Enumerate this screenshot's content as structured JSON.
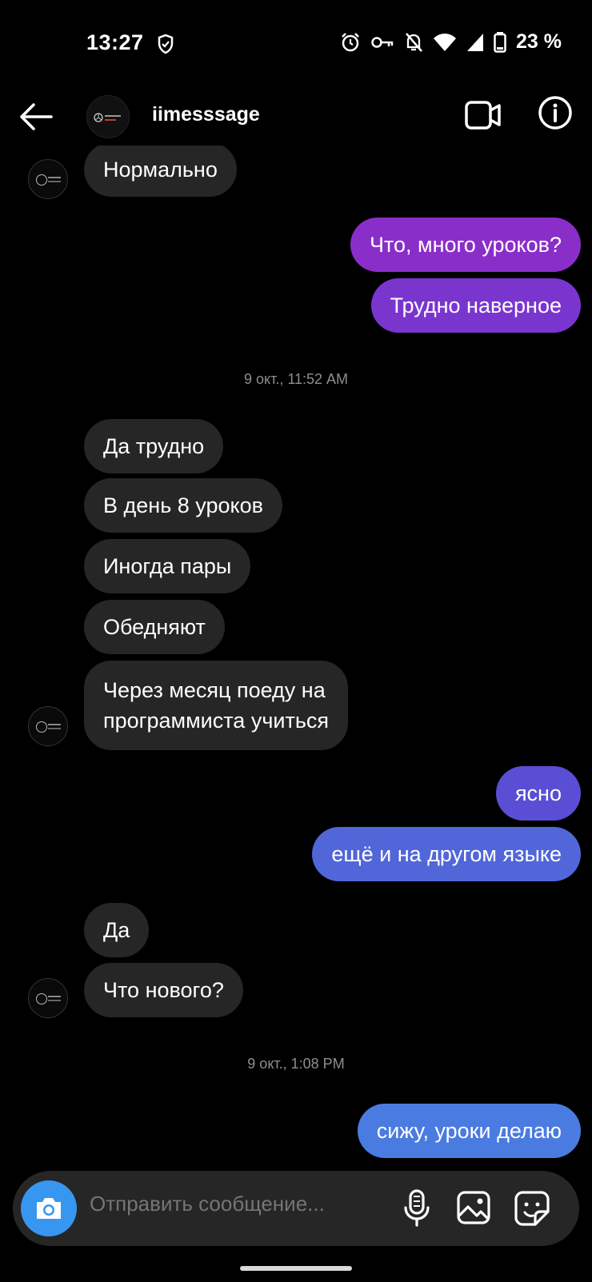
{
  "status": {
    "time": "13:27",
    "battery": "23 %"
  },
  "header": {
    "title": "iimesssage"
  },
  "colors": {
    "in_bubble": "#262626",
    "out_purple": "#8a2ec9",
    "out_violet": "#7a35cf",
    "out_indigo": "#5a4ed4",
    "out_blue": "#4a7be0",
    "accent": "#3797f0"
  },
  "messages": [
    {
      "dir": "in",
      "text": "Нормально"
    },
    {
      "dir": "out",
      "text": "Что, много уроков?"
    },
    {
      "dir": "out",
      "text": "Трудно наверное"
    },
    {
      "dir": "in",
      "text": "Да трудно"
    },
    {
      "dir": "in",
      "text": "В день 8 уроков"
    },
    {
      "dir": "in",
      "text": "Иногда пары"
    },
    {
      "dir": "in",
      "text": "Обедняют"
    },
    {
      "dir": "in",
      "line1": "Через месяц поеду на",
      "line2": "программиста учиться"
    },
    {
      "dir": "out",
      "text": "ясно"
    },
    {
      "dir": "out",
      "text": "ещё и на другом языке"
    },
    {
      "dir": "in",
      "text": "Да"
    },
    {
      "dir": "in",
      "text": "Что нового?"
    },
    {
      "dir": "out",
      "text": "сижу, уроки делаю"
    }
  ],
  "timestamps": [
    "9 окт., 11:52 AM",
    "9 окт., 1:08 PM"
  ],
  "composer": {
    "placeholder": "Отправить сообщение..."
  },
  "icons": [
    "shield-icon",
    "alarm-icon",
    "key-icon",
    "bell-off-icon",
    "wifi-icon",
    "signal-icon",
    "battery-icon",
    "back-arrow-icon",
    "video-call-icon",
    "info-icon",
    "camera-icon",
    "microphone-icon",
    "gallery-icon",
    "sticker-icon"
  ]
}
